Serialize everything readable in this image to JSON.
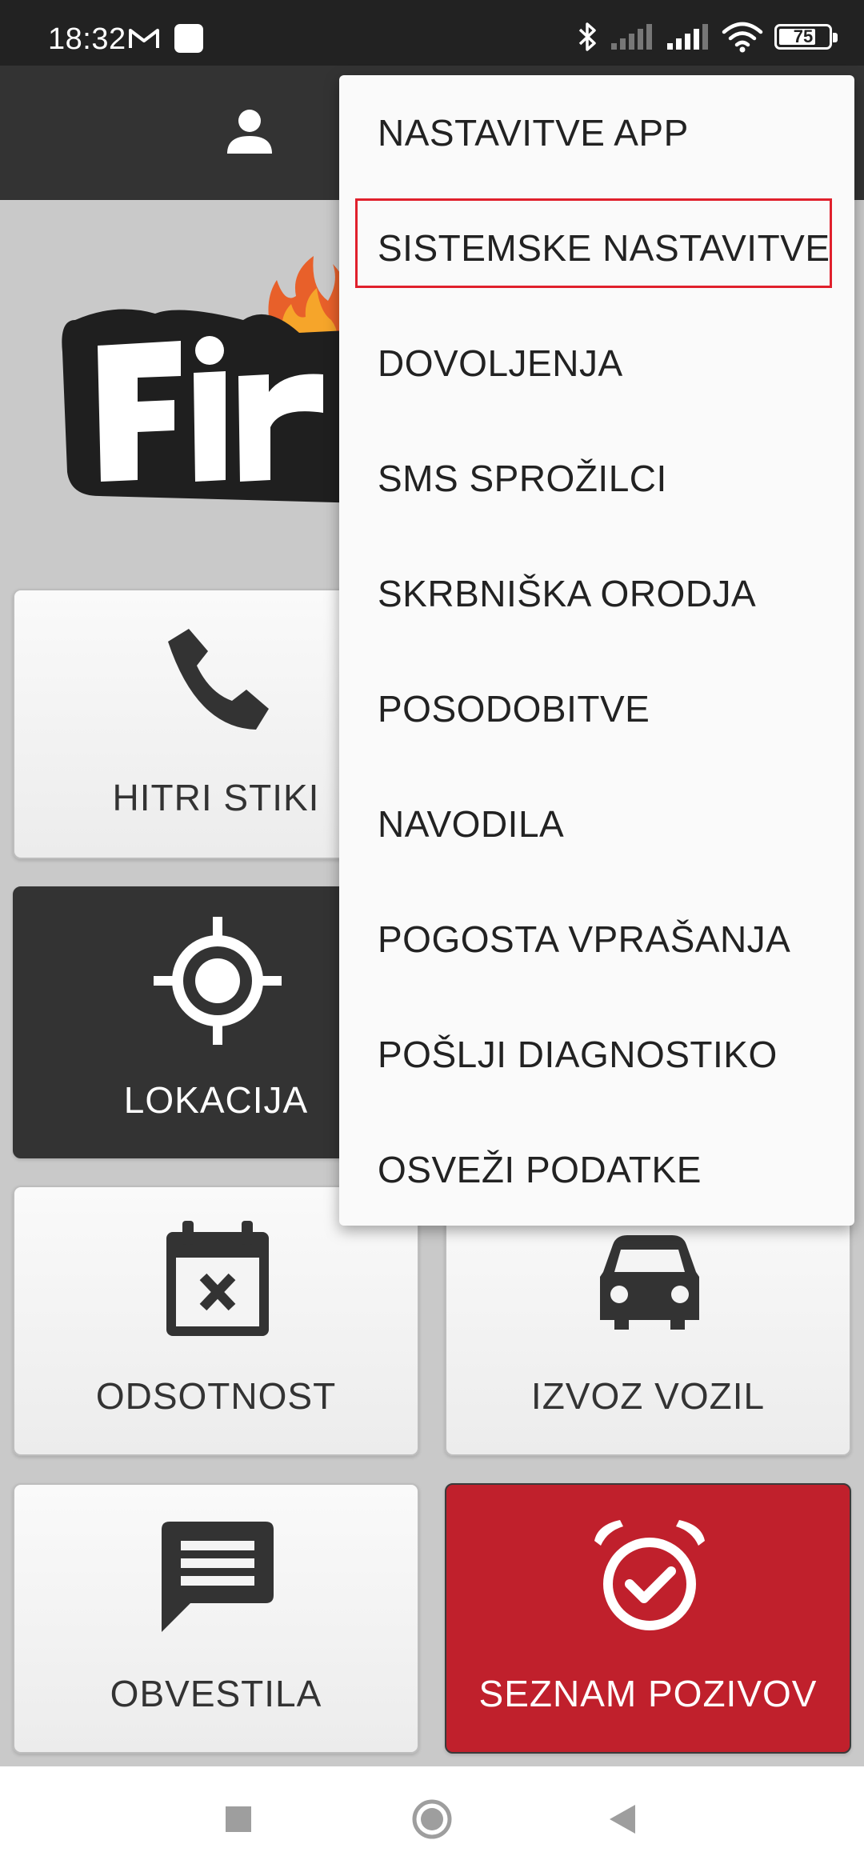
{
  "status_bar": {
    "time": "18:32",
    "battery": "75",
    "battery_level": 0.75
  },
  "tiles": [
    {
      "label": "HITRI STIKI",
      "icon": "phone-icon"
    },
    {
      "label": "LOKACIJA",
      "icon": "crosshair-icon"
    },
    {
      "label": "ODSOTNOST",
      "icon": "calendar-x-icon"
    },
    {
      "label": "IZVOZ VOZIL",
      "icon": "car-icon"
    },
    {
      "label": "OBVESTILA",
      "icon": "message-icon"
    },
    {
      "label": "SEZNAM POZIVOV",
      "icon": "alarm-check-icon"
    }
  ],
  "menu": {
    "items": [
      "NASTAVITVE APP",
      "SISTEMSKE NASTAVITVE",
      "DOVOLJENJA",
      "SMS SPROŽILCI",
      "SKRBNIŠKA ORODJA",
      "POSODOBITVE",
      "NAVODILA",
      "POGOSTA VPRAŠANJA",
      "POŠLJI DIAGNOSTIKO",
      "OSVEŽI PODATKE"
    ],
    "highlighted": "SISTEMSKE NASTAVITVE"
  },
  "colors": {
    "toolbar": "#333333",
    "accent_red": "#c0202c",
    "highlight_border": "#e0202c"
  },
  "icons": {
    "profile": "person-icon",
    "nav_recents": "square-icon",
    "nav_home": "circle-icon",
    "nav_back": "triangle-back-icon"
  }
}
